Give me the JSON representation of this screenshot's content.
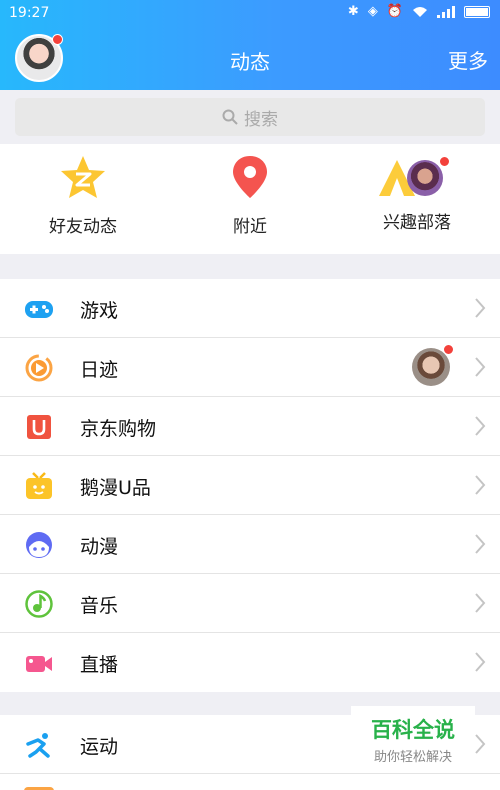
{
  "status_bar": {
    "time": "19:27"
  },
  "header": {
    "title": "动态",
    "more_label": "更多"
  },
  "search": {
    "placeholder": "搜索"
  },
  "quick_links": [
    {
      "label": "好友动态",
      "icon": "star-z-icon"
    },
    {
      "label": "附近",
      "icon": "location-pin-icon"
    },
    {
      "label": "兴趣部落",
      "icon": "tent-icon"
    }
  ],
  "menu_group_1": [
    {
      "label": "游戏",
      "icon": "gamepad-icon"
    },
    {
      "label": "日迹",
      "icon": "play-circle-icon"
    },
    {
      "label": "京东购物",
      "icon": "jd-u-icon"
    },
    {
      "label": "鹅漫U品",
      "icon": "tv-box-icon"
    },
    {
      "label": "动漫",
      "icon": "anime-face-icon"
    },
    {
      "label": "音乐",
      "icon": "music-note-icon"
    },
    {
      "label": "直播",
      "icon": "video-camera-icon"
    }
  ],
  "menu_group_2": [
    {
      "label": "运动",
      "icon": "runner-icon"
    }
  ],
  "watermark": {
    "title": "百科全说",
    "subtitle": "助你轻松解决"
  },
  "colors": {
    "header_start": "#27b8fc",
    "header_end": "#3d8cff",
    "badge": "#f3413b"
  }
}
